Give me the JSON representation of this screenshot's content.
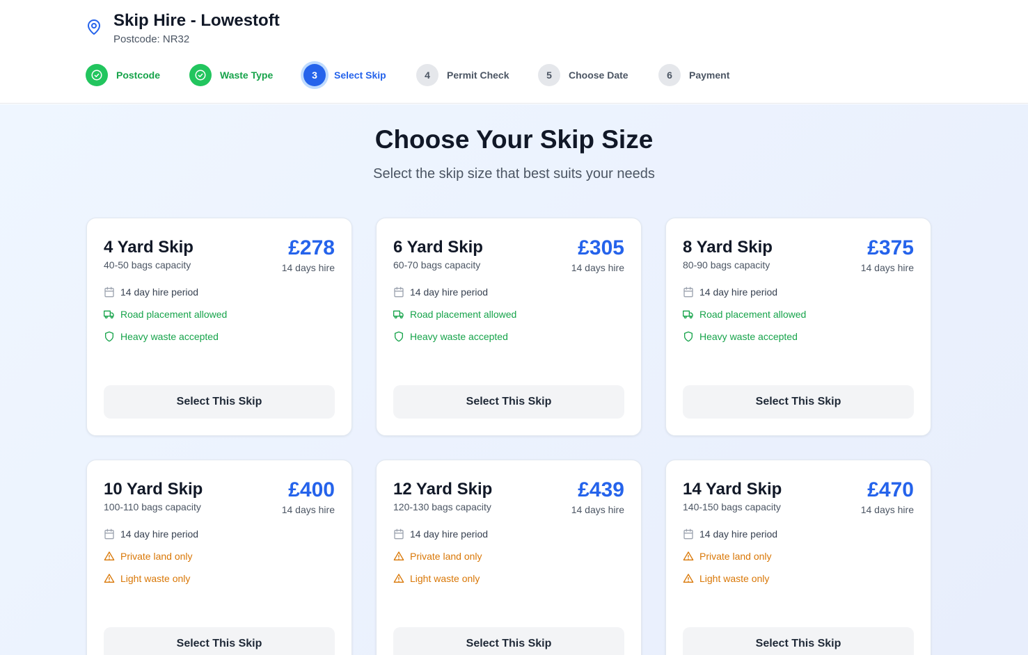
{
  "header": {
    "title": "Skip Hire - Lowestoft",
    "postcode": "Postcode: NR32"
  },
  "steps": [
    {
      "num": "",
      "label": "Postcode",
      "state": "done"
    },
    {
      "num": "",
      "label": "Waste Type",
      "state": "done"
    },
    {
      "num": "3",
      "label": "Select Skip",
      "state": "active"
    },
    {
      "num": "4",
      "label": "Permit Check",
      "state": "todo"
    },
    {
      "num": "5",
      "label": "Choose Date",
      "state": "todo"
    },
    {
      "num": "6",
      "label": "Payment",
      "state": "todo"
    }
  ],
  "main": {
    "title": "Choose Your Skip Size",
    "subtitle": "Select the skip size that best suits your needs"
  },
  "skips": [
    {
      "name": "4 Yard Skip",
      "capacity": "40-50 bags capacity",
      "price": "£278",
      "period": "14 days hire",
      "hire_period": "14 day hire period",
      "placement": "Road placement allowed",
      "waste": "Heavy waste accepted",
      "button": "Select This Skip"
    },
    {
      "name": "6 Yard Skip",
      "capacity": "60-70 bags capacity",
      "price": "£305",
      "period": "14 days hire",
      "hire_period": "14 day hire period",
      "placement": "Road placement allowed",
      "waste": "Heavy waste accepted",
      "button": "Select This Skip"
    },
    {
      "name": "8 Yard Skip",
      "capacity": "80-90 bags capacity",
      "price": "£375",
      "period": "14 days hire",
      "hire_period": "14 day hire period",
      "placement": "Road placement allowed",
      "waste": "Heavy waste accepted",
      "button": "Select This Skip"
    },
    {
      "name": "10 Yard Skip",
      "capacity": "100-110 bags capacity",
      "price": "£400",
      "period": "14 days hire",
      "hire_period": "14 day hire period",
      "placement": "Private land only",
      "waste": "Light waste only",
      "button": "Select This Skip"
    },
    {
      "name": "12 Yard Skip",
      "capacity": "120-130 bags capacity",
      "price": "£439",
      "period": "14 days hire",
      "hire_period": "14 day hire period",
      "placement": "Private land only",
      "waste": "Light waste only",
      "button": "Select This Skip"
    },
    {
      "name": "14 Yard Skip",
      "capacity": "140-150 bags capacity",
      "price": "£470",
      "period": "14 days hire",
      "hire_period": "14 day hire period",
      "placement": "Private land only",
      "waste": "Light waste only",
      "button": "Select This Skip"
    }
  ],
  "colors": {
    "accent": "#2563eb",
    "success": "#16a34a",
    "warning": "#d97706"
  }
}
